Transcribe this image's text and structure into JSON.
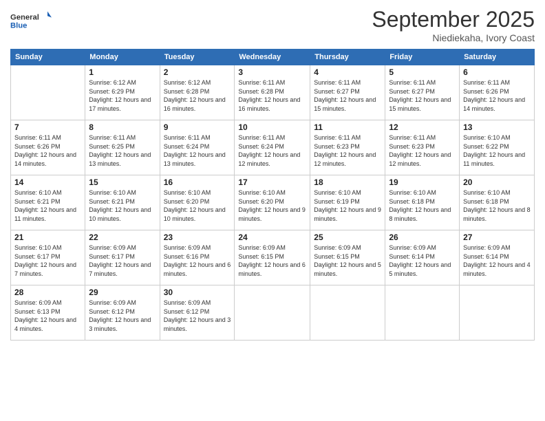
{
  "logo": {
    "general": "General",
    "blue": "Blue"
  },
  "header": {
    "month": "September 2025",
    "location": "Niediekaha, Ivory Coast"
  },
  "days_of_week": [
    "Sunday",
    "Monday",
    "Tuesday",
    "Wednesday",
    "Thursday",
    "Friday",
    "Saturday"
  ],
  "weeks": [
    [
      {
        "day": "",
        "info": ""
      },
      {
        "day": "1",
        "sunrise": "Sunrise: 6:12 AM",
        "sunset": "Sunset: 6:29 PM",
        "daylight": "Daylight: 12 hours and 17 minutes."
      },
      {
        "day": "2",
        "sunrise": "Sunrise: 6:12 AM",
        "sunset": "Sunset: 6:28 PM",
        "daylight": "Daylight: 12 hours and 16 minutes."
      },
      {
        "day": "3",
        "sunrise": "Sunrise: 6:11 AM",
        "sunset": "Sunset: 6:28 PM",
        "daylight": "Daylight: 12 hours and 16 minutes."
      },
      {
        "day": "4",
        "sunrise": "Sunrise: 6:11 AM",
        "sunset": "Sunset: 6:27 PM",
        "daylight": "Daylight: 12 hours and 15 minutes."
      },
      {
        "day": "5",
        "sunrise": "Sunrise: 6:11 AM",
        "sunset": "Sunset: 6:27 PM",
        "daylight": "Daylight: 12 hours and 15 minutes."
      },
      {
        "day": "6",
        "sunrise": "Sunrise: 6:11 AM",
        "sunset": "Sunset: 6:26 PM",
        "daylight": "Daylight: 12 hours and 14 minutes."
      }
    ],
    [
      {
        "day": "7",
        "sunrise": "Sunrise: 6:11 AM",
        "sunset": "Sunset: 6:26 PM",
        "daylight": "Daylight: 12 hours and 14 minutes."
      },
      {
        "day": "8",
        "sunrise": "Sunrise: 6:11 AM",
        "sunset": "Sunset: 6:25 PM",
        "daylight": "Daylight: 12 hours and 13 minutes."
      },
      {
        "day": "9",
        "sunrise": "Sunrise: 6:11 AM",
        "sunset": "Sunset: 6:24 PM",
        "daylight": "Daylight: 12 hours and 13 minutes."
      },
      {
        "day": "10",
        "sunrise": "Sunrise: 6:11 AM",
        "sunset": "Sunset: 6:24 PM",
        "daylight": "Daylight: 12 hours and 12 minutes."
      },
      {
        "day": "11",
        "sunrise": "Sunrise: 6:11 AM",
        "sunset": "Sunset: 6:23 PM",
        "daylight": "Daylight: 12 hours and 12 minutes."
      },
      {
        "day": "12",
        "sunrise": "Sunrise: 6:11 AM",
        "sunset": "Sunset: 6:23 PM",
        "daylight": "Daylight: 12 hours and 12 minutes."
      },
      {
        "day": "13",
        "sunrise": "Sunrise: 6:10 AM",
        "sunset": "Sunset: 6:22 PM",
        "daylight": "Daylight: 12 hours and 11 minutes."
      }
    ],
    [
      {
        "day": "14",
        "sunrise": "Sunrise: 6:10 AM",
        "sunset": "Sunset: 6:21 PM",
        "daylight": "Daylight: 12 hours and 11 minutes."
      },
      {
        "day": "15",
        "sunrise": "Sunrise: 6:10 AM",
        "sunset": "Sunset: 6:21 PM",
        "daylight": "Daylight: 12 hours and 10 minutes."
      },
      {
        "day": "16",
        "sunrise": "Sunrise: 6:10 AM",
        "sunset": "Sunset: 6:20 PM",
        "daylight": "Daylight: 12 hours and 10 minutes."
      },
      {
        "day": "17",
        "sunrise": "Sunrise: 6:10 AM",
        "sunset": "Sunset: 6:20 PM",
        "daylight": "Daylight: 12 hours and 9 minutes."
      },
      {
        "day": "18",
        "sunrise": "Sunrise: 6:10 AM",
        "sunset": "Sunset: 6:19 PM",
        "daylight": "Daylight: 12 hours and 9 minutes."
      },
      {
        "day": "19",
        "sunrise": "Sunrise: 6:10 AM",
        "sunset": "Sunset: 6:18 PM",
        "daylight": "Daylight: 12 hours and 8 minutes."
      },
      {
        "day": "20",
        "sunrise": "Sunrise: 6:10 AM",
        "sunset": "Sunset: 6:18 PM",
        "daylight": "Daylight: 12 hours and 8 minutes."
      }
    ],
    [
      {
        "day": "21",
        "sunrise": "Sunrise: 6:10 AM",
        "sunset": "Sunset: 6:17 PM",
        "daylight": "Daylight: 12 hours and 7 minutes."
      },
      {
        "day": "22",
        "sunrise": "Sunrise: 6:09 AM",
        "sunset": "Sunset: 6:17 PM",
        "daylight": "Daylight: 12 hours and 7 minutes."
      },
      {
        "day": "23",
        "sunrise": "Sunrise: 6:09 AM",
        "sunset": "Sunset: 6:16 PM",
        "daylight": "Daylight: 12 hours and 6 minutes."
      },
      {
        "day": "24",
        "sunrise": "Sunrise: 6:09 AM",
        "sunset": "Sunset: 6:15 PM",
        "daylight": "Daylight: 12 hours and 6 minutes."
      },
      {
        "day": "25",
        "sunrise": "Sunrise: 6:09 AM",
        "sunset": "Sunset: 6:15 PM",
        "daylight": "Daylight: 12 hours and 5 minutes."
      },
      {
        "day": "26",
        "sunrise": "Sunrise: 6:09 AM",
        "sunset": "Sunset: 6:14 PM",
        "daylight": "Daylight: 12 hours and 5 minutes."
      },
      {
        "day": "27",
        "sunrise": "Sunrise: 6:09 AM",
        "sunset": "Sunset: 6:14 PM",
        "daylight": "Daylight: 12 hours and 4 minutes."
      }
    ],
    [
      {
        "day": "28",
        "sunrise": "Sunrise: 6:09 AM",
        "sunset": "Sunset: 6:13 PM",
        "daylight": "Daylight: 12 hours and 4 minutes."
      },
      {
        "day": "29",
        "sunrise": "Sunrise: 6:09 AM",
        "sunset": "Sunset: 6:12 PM",
        "daylight": "Daylight: 12 hours and 3 minutes."
      },
      {
        "day": "30",
        "sunrise": "Sunrise: 6:09 AM",
        "sunset": "Sunset: 6:12 PM",
        "daylight": "Daylight: 12 hours and 3 minutes."
      },
      {
        "day": "",
        "info": ""
      },
      {
        "day": "",
        "info": ""
      },
      {
        "day": "",
        "info": ""
      },
      {
        "day": "",
        "info": ""
      }
    ]
  ]
}
